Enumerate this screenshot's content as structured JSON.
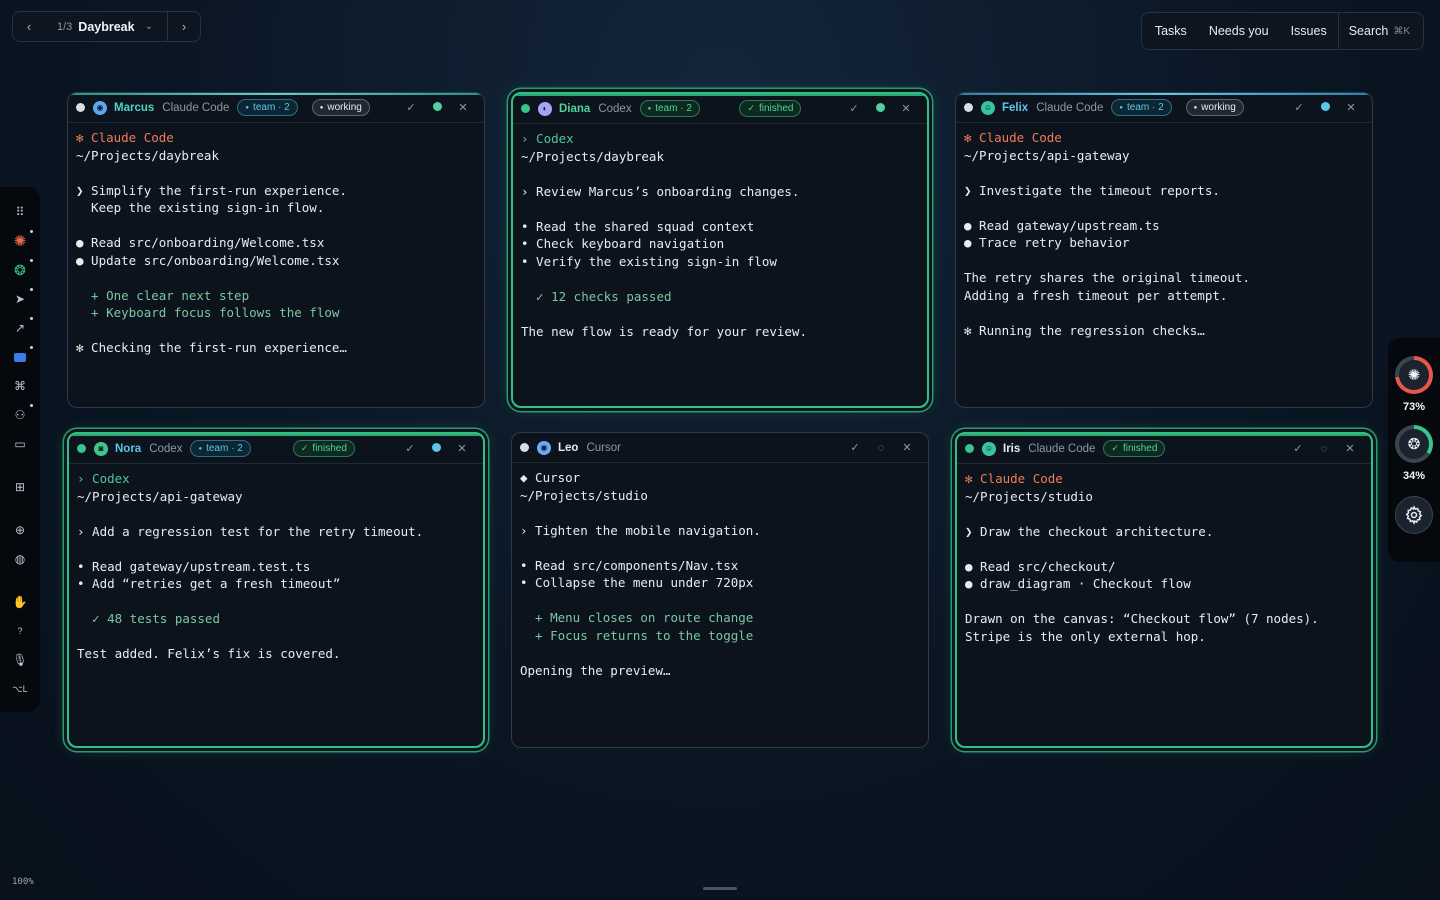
{
  "workspace": {
    "counter": "1/3",
    "name": "Daybreak"
  },
  "nav": {
    "items": [
      "Tasks",
      "Needs you",
      "Issues"
    ],
    "search_label": "Search",
    "search_shortcut": "⌘K"
  },
  "zoom": "100%",
  "usage": [
    {
      "icon": "claude-icon",
      "percent": "73%",
      "fraction": 0.73,
      "color": "#e8574a"
    },
    {
      "icon": "openai-icon",
      "percent": "34%",
      "fraction": 0.34,
      "color": "#39c489"
    }
  ],
  "cards": [
    {
      "agent": "Marcus",
      "tool": "Claude Code",
      "team": "team · 2",
      "status": "working",
      "agent_color": "#4fd1c5",
      "lines": [
        {
          "t": "✻ Claude Code",
          "c": "orange"
        },
        {
          "t": "~/Projects/daybreak",
          "c": ""
        },
        {
          "t": "",
          "c": ""
        },
        {
          "t": "❯ Simplify the first-run experience.",
          "c": ""
        },
        {
          "t": "  Keep the existing sign-in flow.",
          "c": ""
        },
        {
          "t": "",
          "c": ""
        },
        {
          "t": "● Read src/onboarding/Welcome.tsx",
          "c": ""
        },
        {
          "t": "● Update src/onboarding/Welcome.tsx",
          "c": ""
        },
        {
          "t": "",
          "c": ""
        },
        {
          "t": "  + One clear next step",
          "c": "green"
        },
        {
          "t": "  + Keyboard focus follows the flow",
          "c": "green"
        },
        {
          "t": "",
          "c": ""
        },
        {
          "t": "✻ Checking the first-run experience…",
          "c": ""
        }
      ]
    },
    {
      "agent": "Diana",
      "tool": "Codex",
      "team": "team · 2",
      "status": "finished",
      "agent_color": "#4fd19a",
      "lines": [
        {
          "t": "› Codex",
          "c": "teal"
        },
        {
          "t": "~/Projects/daybreak",
          "c": ""
        },
        {
          "t": "",
          "c": ""
        },
        {
          "t": "› Review Marcus’s onboarding changes.",
          "c": ""
        },
        {
          "t": "",
          "c": ""
        },
        {
          "t": "• Read the shared squad context",
          "c": ""
        },
        {
          "t": "• Check keyboard navigation",
          "c": ""
        },
        {
          "t": "• Verify the existing sign-in flow",
          "c": ""
        },
        {
          "t": "",
          "c": ""
        },
        {
          "t": "  ✓ 12 checks passed",
          "c": "green"
        },
        {
          "t": "",
          "c": ""
        },
        {
          "t": "The new flow is ready for your review.",
          "c": ""
        }
      ]
    },
    {
      "agent": "Felix",
      "tool": "Claude Code",
      "team": "team · 2",
      "status": "working",
      "agent_color": "#5cc6e8",
      "lines": [
        {
          "t": "✻ Claude Code",
          "c": "orange"
        },
        {
          "t": "~/Projects/api-gateway",
          "c": ""
        },
        {
          "t": "",
          "c": ""
        },
        {
          "t": "❯ Investigate the timeout reports.",
          "c": ""
        },
        {
          "t": "",
          "c": ""
        },
        {
          "t": "● Read gateway/upstream.ts",
          "c": ""
        },
        {
          "t": "● Trace retry behavior",
          "c": ""
        },
        {
          "t": "",
          "c": ""
        },
        {
          "t": "The retry shares the original timeout.",
          "c": ""
        },
        {
          "t": "Adding a fresh timeout per attempt.",
          "c": ""
        },
        {
          "t": "",
          "c": ""
        },
        {
          "t": "✻ Running the regression checks…",
          "c": ""
        }
      ]
    },
    {
      "agent": "Nora",
      "tool": "Codex",
      "team": "team · 2",
      "status": "finished",
      "agent_color": "#5cc6e8",
      "lines": [
        {
          "t": "› Codex",
          "c": "teal"
        },
        {
          "t": "~/Projects/api-gateway",
          "c": ""
        },
        {
          "t": "",
          "c": ""
        },
        {
          "t": "› Add a regression test for the retry timeout.",
          "c": ""
        },
        {
          "t": "",
          "c": ""
        },
        {
          "t": "• Read gateway/upstream.test.ts",
          "c": ""
        },
        {
          "t": "• Add “retries get a fresh timeout”",
          "c": ""
        },
        {
          "t": "",
          "c": ""
        },
        {
          "t": "  ✓ 48 tests passed",
          "c": "green"
        },
        {
          "t": "",
          "c": ""
        },
        {
          "t": "Test added. Felix’s fix is covered.",
          "c": ""
        }
      ]
    },
    {
      "agent": "Leo",
      "tool": "Cursor",
      "team": "",
      "status": "",
      "agent_color": "#e6ebf1",
      "lines": [
        {
          "t": "◆ Cursor",
          "c": ""
        },
        {
          "t": "~/Projects/studio",
          "c": ""
        },
        {
          "t": "",
          "c": ""
        },
        {
          "t": "› Tighten the mobile navigation.",
          "c": ""
        },
        {
          "t": "",
          "c": ""
        },
        {
          "t": "• Read src/components/Nav.tsx",
          "c": ""
        },
        {
          "t": "• Collapse the menu under 720px",
          "c": ""
        },
        {
          "t": "",
          "c": ""
        },
        {
          "t": "  + Menu closes on route change",
          "c": "green"
        },
        {
          "t": "  + Focus returns to the toggle",
          "c": "green"
        },
        {
          "t": "",
          "c": ""
        },
        {
          "t": "Opening the preview…",
          "c": ""
        }
      ]
    },
    {
      "agent": "Iris",
      "tool": "Claude Code",
      "team": "",
      "status": "finished",
      "agent_color": "#e6ebf1",
      "lines": [
        {
          "t": "✻ Claude Code",
          "c": "orange"
        },
        {
          "t": "~/Projects/studio",
          "c": ""
        },
        {
          "t": "",
          "c": ""
        },
        {
          "t": "❯ Draw the checkout architecture.",
          "c": ""
        },
        {
          "t": "",
          "c": ""
        },
        {
          "t": "● Read src/checkout/",
          "c": ""
        },
        {
          "t": "● draw_diagram · Checkout flow",
          "c": ""
        },
        {
          "t": "",
          "c": ""
        },
        {
          "t": "Drawn on the canvas: “Checkout flow” (7 nodes).",
          "c": ""
        },
        {
          "t": "Stripe is the only external hop.",
          "c": ""
        }
      ]
    }
  ]
}
